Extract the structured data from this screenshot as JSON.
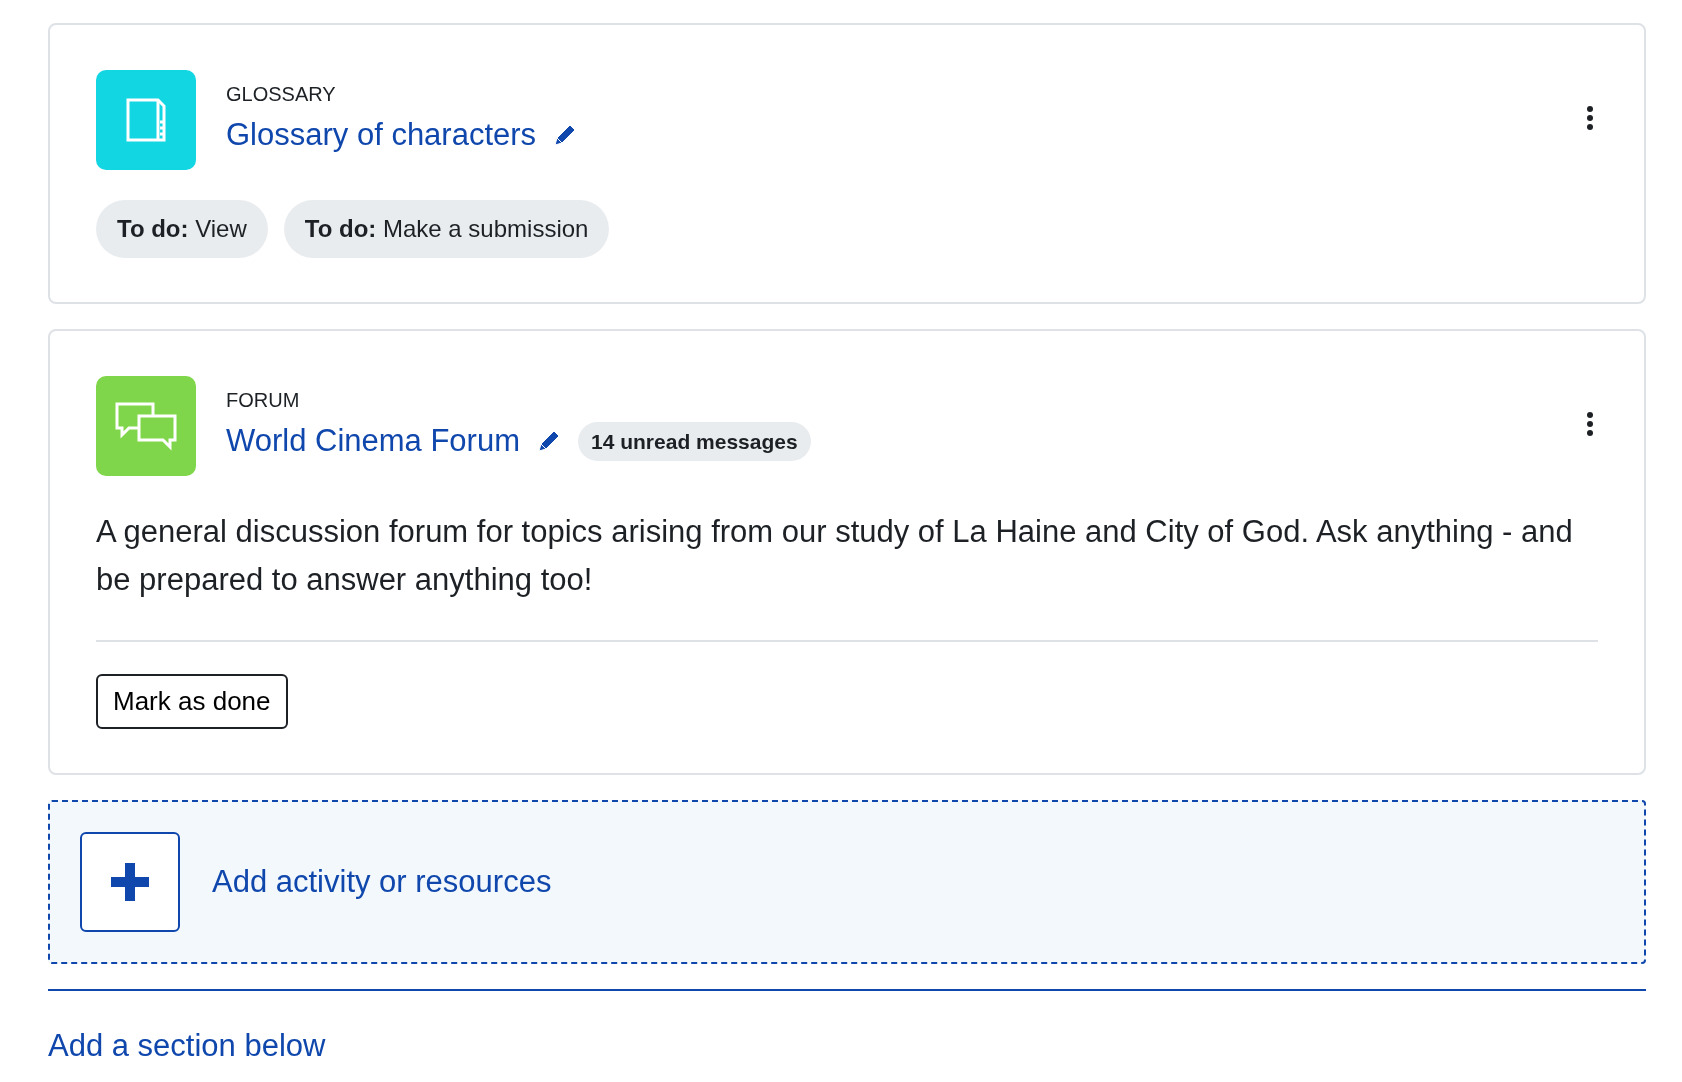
{
  "activities": [
    {
      "kind": "glossary",
      "type_label": "GLOSSARY",
      "title": "Glossary of characters",
      "completion": [
        "**To do:** View",
        "**To do:** Make a submission"
      ]
    },
    {
      "kind": "forum",
      "type_label": "FORUM",
      "title": "World Cinema Forum",
      "unread_badge": "14 unread messages",
      "description": "A general discussion forum for topics arising from our study of La Haine and City of God. Ask anything - and be prepared to answer anything too!",
      "button": "Mark as done"
    }
  ],
  "add_activity": {
    "label": "Add activity or resources"
  },
  "add_section": {
    "label": "Add a section below"
  }
}
